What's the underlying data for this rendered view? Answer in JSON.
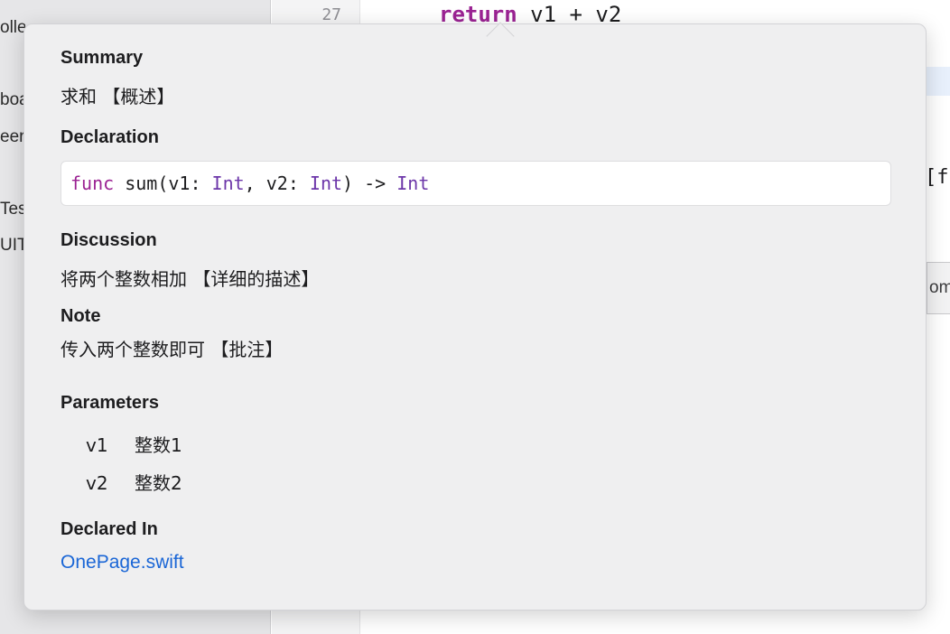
{
  "background": {
    "sidebar_fragments": [
      "olle",
      "boa",
      "eer",
      "Tes",
      "UIT"
    ],
    "editor": {
      "line_number": "27",
      "code_keyword": "return",
      "code_rest": " v1 + v2",
      "right_fragment": "[fi",
      "right_button_fragment": "om"
    }
  },
  "quick_help": {
    "summary": {
      "title": "Summary",
      "text": "求和 【概述】"
    },
    "declaration": {
      "title": "Declaration",
      "tokens": {
        "keyword": "func",
        "name_open": " sum(v1: ",
        "type1": "Int",
        "sep": ", v2: ",
        "type2": "Int",
        "arrow": ") -> ",
        "type3": "Int"
      }
    },
    "discussion": {
      "title": "Discussion",
      "text": "将两个整数相加 【详细的描述】"
    },
    "note": {
      "title": "Note",
      "text": "传入两个整数即可 【批注】"
    },
    "parameters": {
      "title": "Parameters",
      "items": [
        {
          "name": "v1",
          "description": "整数1"
        },
        {
          "name": "v2",
          "description": "整数2"
        }
      ]
    },
    "declared_in": {
      "title": "Declared In",
      "link": "OnePage.swift"
    }
  },
  "colors": {
    "keyword": "#9b2393",
    "type": "#6c36a9",
    "link": "#1a66d6",
    "popover_bg": "#efeff0"
  }
}
